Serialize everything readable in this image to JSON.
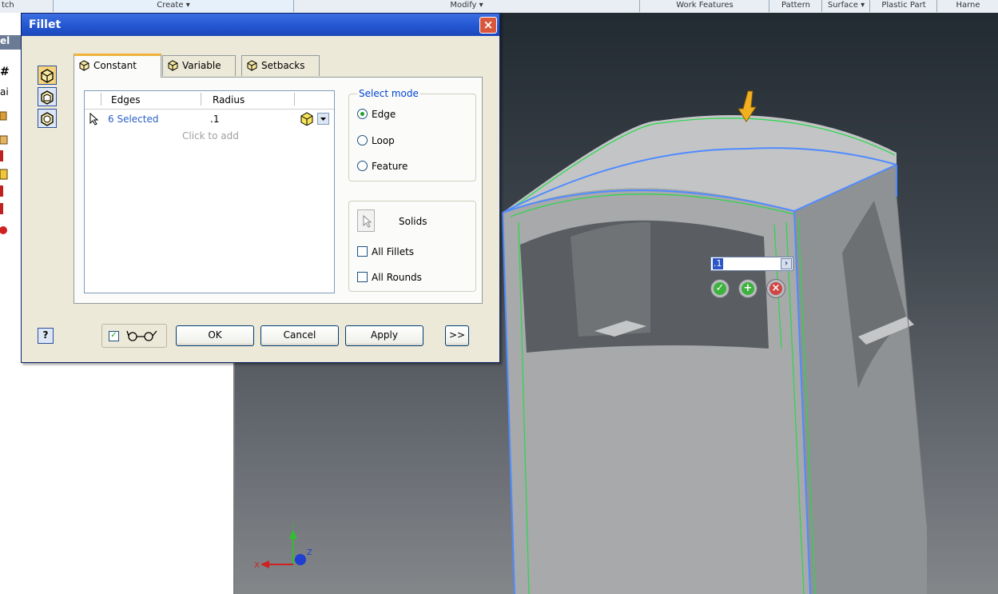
{
  "ribbon": {
    "cells": [
      "tch",
      "Create ▾",
      "Modify ▾",
      "Work Features",
      "Pattern",
      "Surface ▾",
      "Plastic Part",
      "Harne"
    ]
  },
  "browser": {
    "fragments": [
      "el",
      "ai"
    ]
  },
  "dialog": {
    "title": "Fillet",
    "close_label": "×",
    "tabs": [
      {
        "label": "Constant"
      },
      {
        "label": "Variable"
      },
      {
        "label": "Setbacks"
      }
    ],
    "grid": {
      "col_edges": "Edges",
      "col_radius": "Radius",
      "row_edges": "6 Selected",
      "row_radius": ".1",
      "click_to_add": "Click to add"
    },
    "select_mode": {
      "title": "Select mode",
      "options": [
        "Edge",
        "Loop",
        "Feature"
      ],
      "selected": "Edge"
    },
    "solids": {
      "label": "Solids",
      "all_fillets": "All Fillets",
      "all_rounds": "All Rounds"
    },
    "buttons": {
      "ok": "OK",
      "cancel": "Cancel",
      "apply": "Apply",
      "more": ">>",
      "help": "?"
    }
  },
  "mini_toolbar": {
    "value": ".1",
    "expand": "›"
  },
  "axis": {
    "x": "X",
    "y": "Y",
    "z": "Z"
  },
  "colors": {
    "titlebar": "#2558d4",
    "dialog_bg": "#ece9d8",
    "accent_tab": "#f0b33a",
    "link_blue": "#2b5fc8",
    "edge_green": "#29d84a",
    "edge_blue": "#4f8bff"
  }
}
